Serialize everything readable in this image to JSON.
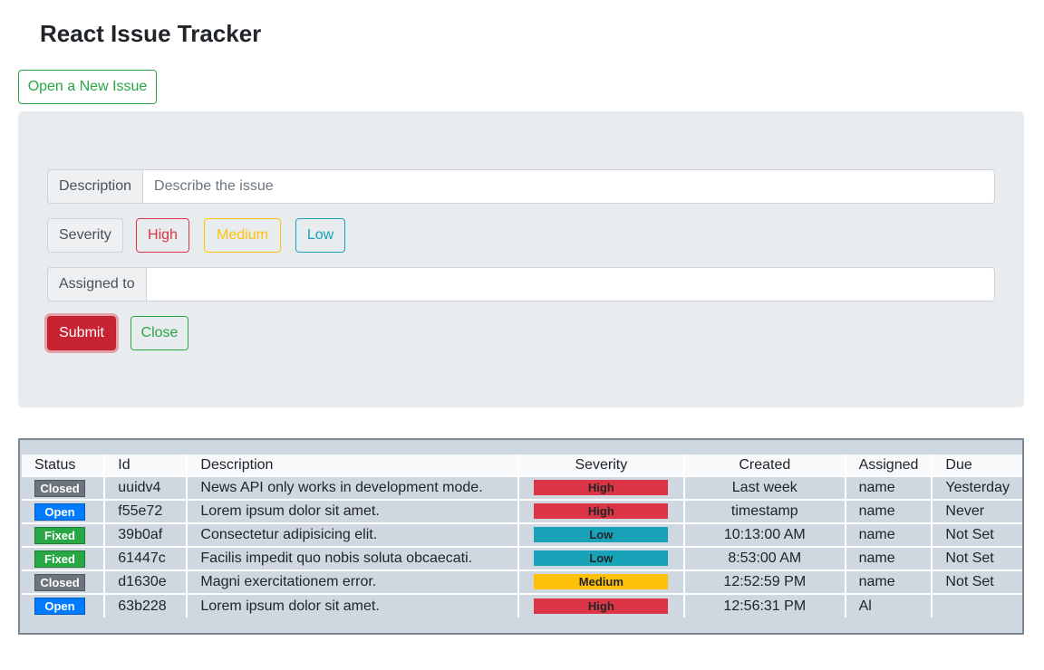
{
  "header": {
    "title": "React Issue Tracker"
  },
  "toolbar": {
    "open_new_label": "Open a New Issue"
  },
  "form": {
    "description_label": "Description",
    "description_placeholder": "Describe the issue",
    "description_value": "",
    "severity_label": "Severity",
    "severity_options": [
      "High",
      "Medium",
      "Low"
    ],
    "assigned_label": "Assigned to",
    "assigned_value": "",
    "submit_label": "Submit",
    "close_label": "Close"
  },
  "table": {
    "columns": [
      "Status",
      "Id",
      "Description",
      "Severity",
      "Created",
      "Assigned",
      "Due"
    ],
    "rows": [
      {
        "status": "Closed",
        "id": "uuidv4",
        "description": "News API only works in development mode.",
        "severity": "High",
        "created": "Last week",
        "assigned": "name",
        "due": "Yesterday"
      },
      {
        "status": "Open",
        "id": "f55e72",
        "description": "Lorem ipsum dolor sit amet.",
        "severity": "High",
        "created": "timestamp",
        "assigned": "name",
        "due": "Never"
      },
      {
        "status": "Fixed",
        "id": "39b0af",
        "description": "Consectetur adipisicing elit.",
        "severity": "Low",
        "created": "10:13:00 AM",
        "assigned": "name",
        "due": "Not Set"
      },
      {
        "status": "Fixed",
        "id": "61447c",
        "description": "Facilis impedit quo nobis soluta obcaecati.",
        "severity": "Low",
        "created": "8:53:00 AM",
        "assigned": "name",
        "due": "Not Set"
      },
      {
        "status": "Closed",
        "id": "d1630e",
        "description": "Magni exercitationem error.",
        "severity": "Medium",
        "created": "12:52:59 PM",
        "assigned": "name",
        "due": "Not Set"
      },
      {
        "status": "Open",
        "id": "63b228",
        "description": "Lorem ipsum dolor sit amet.",
        "severity": "High",
        "created": "12:56:31 PM",
        "assigned": "Al",
        "due": ""
      }
    ]
  },
  "colors": {
    "status": {
      "Closed": "#6c757d",
      "Open": "#007bff",
      "Fixed": "#28a745"
    },
    "severity": {
      "High": "#dc3545",
      "Medium": "#ffc107",
      "Low": "#17a2b8"
    },
    "success": "#28a745",
    "danger": "#c82333"
  }
}
